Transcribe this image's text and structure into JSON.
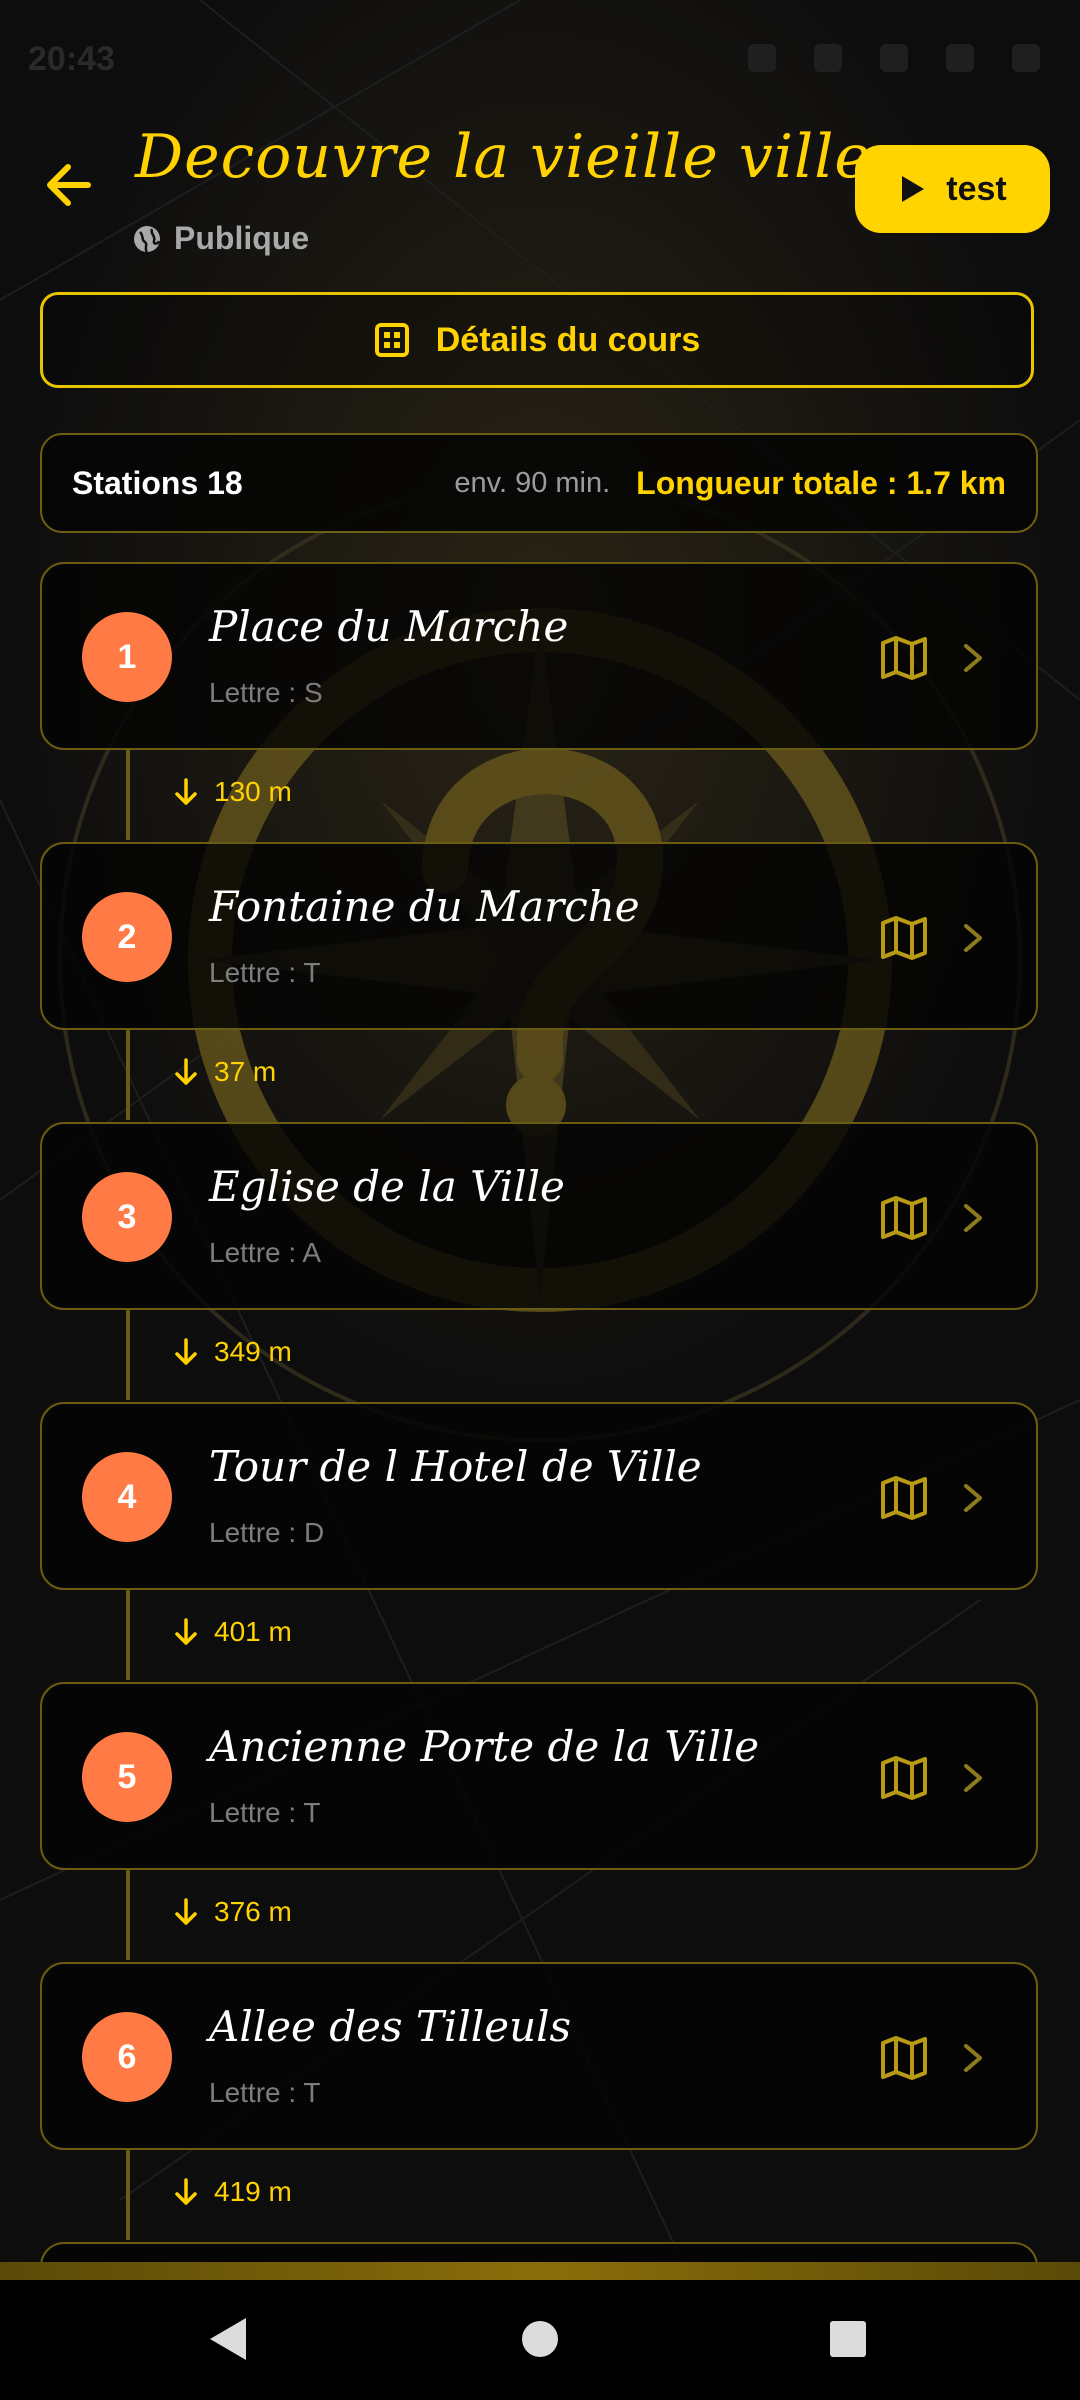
{
  "status_bar": {
    "time": "20:43"
  },
  "header": {
    "title": "Decouvre la vieille ville",
    "visibility": "Publique",
    "test_button": "test",
    "details_button": "Détails du cours"
  },
  "stats": {
    "stations": "Stations 18",
    "duration": "env. 90 min.",
    "total_length": "Longueur totale : 1.7 km"
  },
  "stations": [
    {
      "num": "1",
      "name": "Place du Marche",
      "letter": "Lettre : S",
      "distance_next": "130 m"
    },
    {
      "num": "2",
      "name": "Fontaine du Marche",
      "letter": "Lettre : T",
      "distance_next": "37 m"
    },
    {
      "num": "3",
      "name": "Eglise de la Ville",
      "letter": "Lettre : A",
      "distance_next": "349 m"
    },
    {
      "num": "4",
      "name": "Tour de l Hotel de Ville",
      "letter": "Lettre : D",
      "distance_next": "401 m"
    },
    {
      "num": "5",
      "name": "Ancienne Porte de la Ville",
      "letter": "Lettre : T",
      "distance_next": "376 m"
    },
    {
      "num": "6",
      "name": "Allee des Tilleuls",
      "letter": "Lettre : T",
      "distance_next": "419 m"
    }
  ],
  "icons": {
    "back": "arrow-left-icon",
    "visibility": "globe-icon",
    "test": "play-icon",
    "details": "grid-icon",
    "map": "map-icon",
    "chevron": "chevron-right-icon",
    "distance": "arrow-down-icon"
  },
  "colors": {
    "accent": "#ffd200",
    "station_badge": "#ff7a45",
    "card_border": "#6a5d12"
  }
}
